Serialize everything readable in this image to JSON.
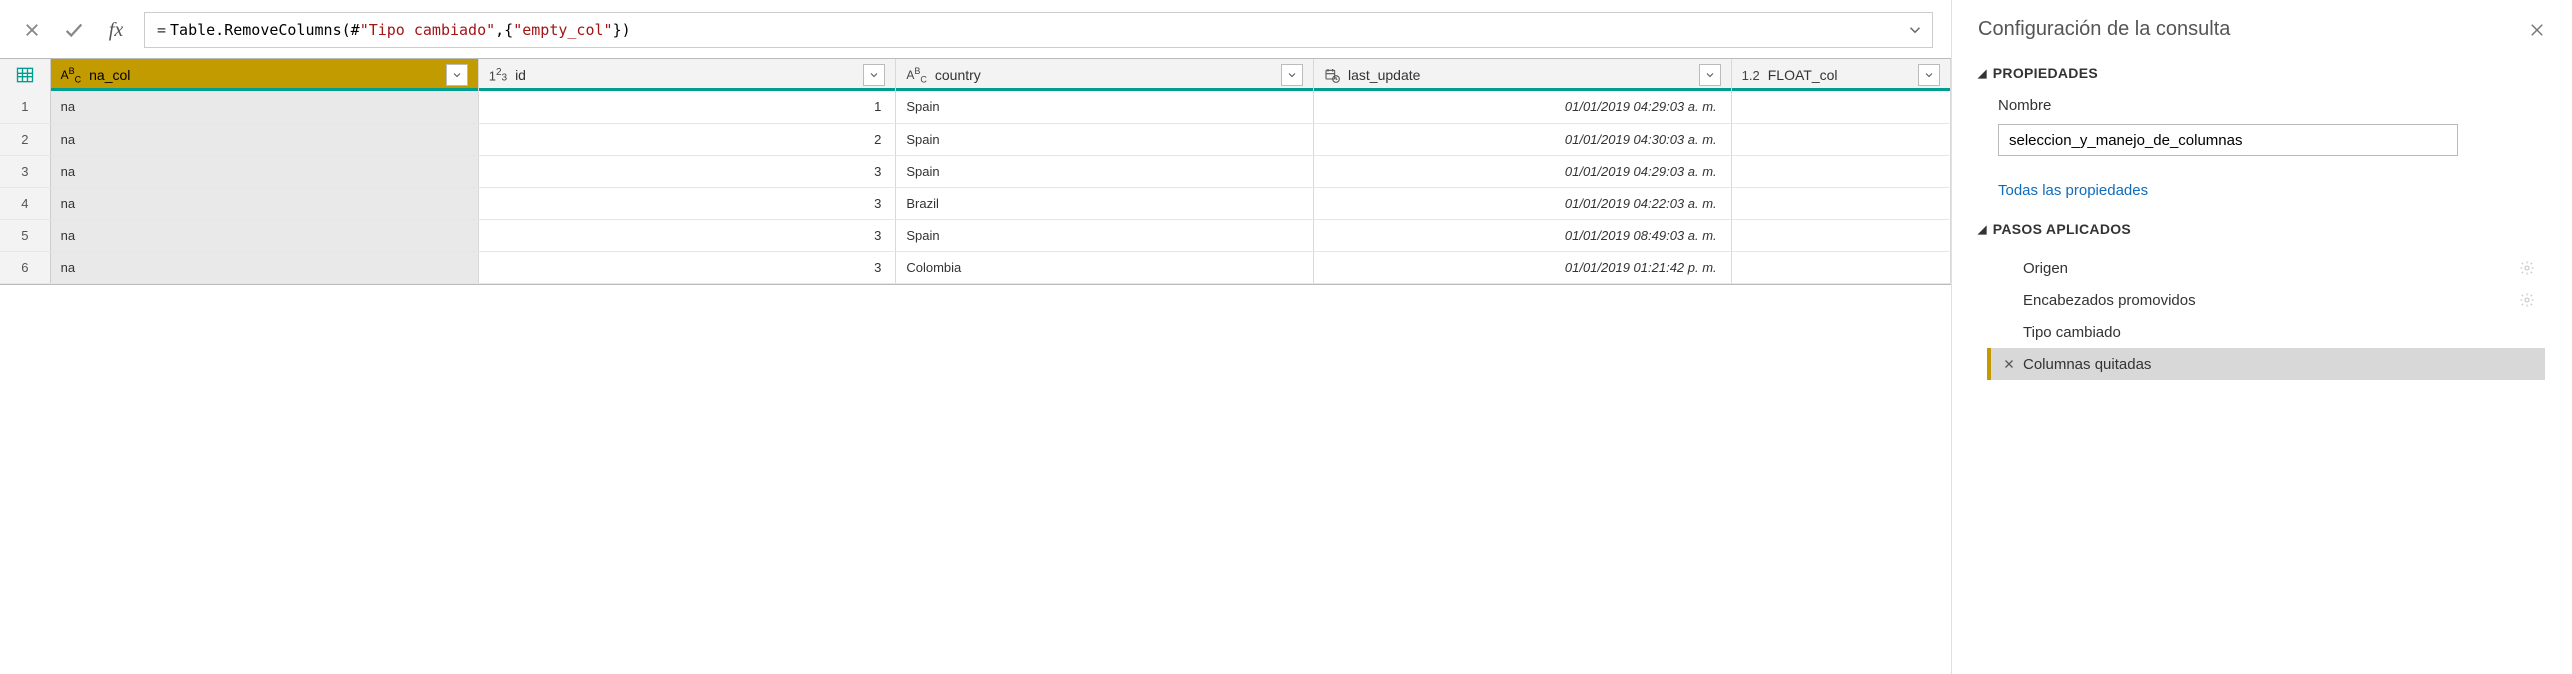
{
  "formula_bar": {
    "prefix": "= ",
    "parts": [
      {
        "t": "Table.RemoveColumns(#",
        "cls": "kw"
      },
      {
        "t": "\"Tipo cambiado\"",
        "cls": "str"
      },
      {
        "t": ",{",
        "cls": "kw"
      },
      {
        "t": "\"empty_col\"",
        "cls": "str"
      },
      {
        "t": "})",
        "cls": "kw"
      }
    ]
  },
  "columns": [
    {
      "key": "na_col",
      "label": "na_col",
      "type": "text",
      "selected": true,
      "width_class": "col-na"
    },
    {
      "key": "id",
      "label": "id",
      "type": "int",
      "selected": false,
      "width_class": "col-id"
    },
    {
      "key": "country",
      "label": "country",
      "type": "text",
      "selected": false,
      "width_class": "col-country"
    },
    {
      "key": "last_update",
      "label": "last_update",
      "type": "datetime",
      "selected": false,
      "width_class": "col-last"
    },
    {
      "key": "FLOAT_col",
      "label": "FLOAT_col",
      "type": "decimal",
      "selected": false,
      "width_class": "col-float"
    }
  ],
  "rows": [
    {
      "na_col": "na",
      "id": "1",
      "country": "Spain",
      "last_update": "01/01/2019 04:29:03 a. m."
    },
    {
      "na_col": "na",
      "id": "2",
      "country": "Spain",
      "last_update": "01/01/2019 04:30:03 a. m."
    },
    {
      "na_col": "na",
      "id": "3",
      "country": "Spain",
      "last_update": "01/01/2019 04:29:03 a. m."
    },
    {
      "na_col": "na",
      "id": "3",
      "country": "Brazil",
      "last_update": "01/01/2019 04:22:03 a. m."
    },
    {
      "na_col": "na",
      "id": "3",
      "country": "Spain",
      "last_update": "01/01/2019 08:49:03 a. m."
    },
    {
      "na_col": "na",
      "id": "3",
      "country": "Colombia",
      "last_update": "01/01/2019 01:21:42 p. m."
    }
  ],
  "side": {
    "title": "Configuración de la consulta",
    "section_properties": "PROPIEDADES",
    "name_label": "Nombre",
    "name_value": "seleccion_y_manejo_de_columnas",
    "all_props_link": "Todas las propiedades",
    "section_steps": "PASOS APLICADOS",
    "steps": [
      {
        "label": "Origen",
        "gear": true,
        "active": false
      },
      {
        "label": "Encabezados promovidos",
        "gear": true,
        "active": false
      },
      {
        "label": "Tipo cambiado",
        "gear": false,
        "active": false
      },
      {
        "label": "Columnas quitadas",
        "gear": false,
        "active": true
      }
    ]
  }
}
